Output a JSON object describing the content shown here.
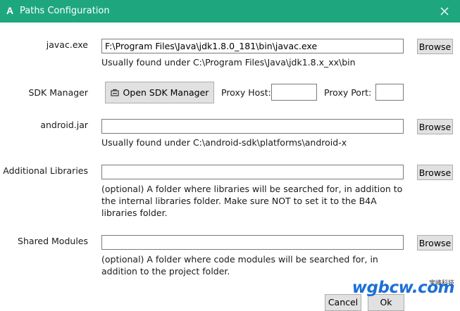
{
  "window": {
    "title": "Paths Configuration",
    "app_icon": "A"
  },
  "javac": {
    "label": "javac.exe",
    "value": "F:\\Program Files\\Java\\jdk1.8.0_181\\bin\\javac.exe",
    "hint": "Usually found under C:\\Program Files\\Java\\jdk1.8.x_xx\\bin",
    "browse": "Browse"
  },
  "sdk": {
    "label": "SDK Manager",
    "button": "Open SDK Manager",
    "button_icon": "sdk-manager-icon",
    "proxy_host_label": "Proxy Host:",
    "proxy_host_value": "",
    "proxy_port_label": "Proxy Port:",
    "proxy_port_value": ""
  },
  "android_jar": {
    "label": "android.jar",
    "value": "",
    "hint": "Usually found under C:\\android-sdk\\platforms\\android-x",
    "browse": "Browse"
  },
  "additional_libraries": {
    "label": "Additional Libraries",
    "value": "",
    "hint": "(optional) A folder where libraries will be searched for, in addition to the internal libraries folder. Make sure NOT to set it to the B4A libraries folder.",
    "browse": "Browse"
  },
  "shared_modules": {
    "label": "Shared Modules",
    "value": "",
    "hint": "(optional) A folder where code modules will be searched for, in addition to the project folder.",
    "browse": "Browse"
  },
  "footer": {
    "cancel": "Cancel",
    "ok": "Ok"
  },
  "watermark": {
    "text": "wgbcw.com",
    "subtext": "宝峰科技"
  },
  "colors": {
    "titlebar": "#1ea77f",
    "button_bg": "#e1e1e1",
    "watermark": "#1d6fd6"
  }
}
